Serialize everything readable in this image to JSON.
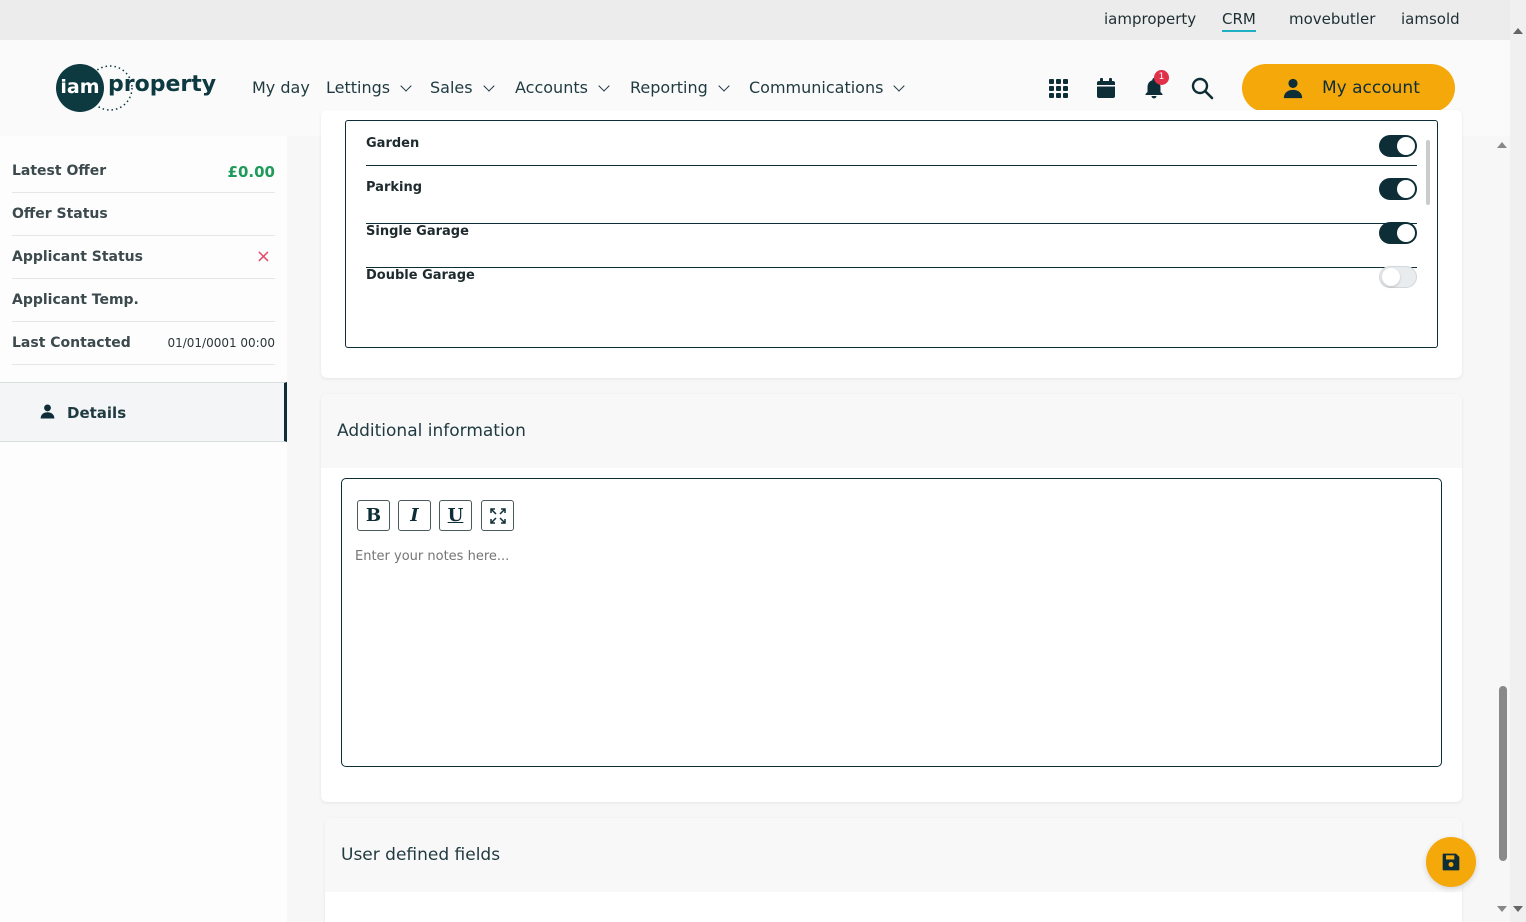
{
  "topbar": {
    "links": [
      "iamproperty",
      "CRM",
      "movebutler",
      "iamsold"
    ],
    "active": "CRM"
  },
  "header": {
    "logo_left": "iam",
    "logo_right": "property",
    "nav": [
      "My day",
      "Lettings",
      "Sales",
      "Accounts",
      "Reporting",
      "Communications"
    ],
    "notification_count": "1",
    "account_label": "My account"
  },
  "sidebar": {
    "rows": [
      {
        "label": "Latest Offer",
        "value": "£0.00"
      },
      {
        "label": "Offer Status",
        "value": ""
      },
      {
        "label": "Applicant Status",
        "value": "×"
      },
      {
        "label": "Applicant Temp.",
        "value": ""
      },
      {
        "label": "Last Contacted",
        "value": "01/01/0001 00:00"
      }
    ],
    "details_label": "Details"
  },
  "amenities": [
    {
      "label": "Garden",
      "on": true
    },
    {
      "label": "Parking",
      "on": true
    },
    {
      "label": "Single Garage",
      "on": true
    },
    {
      "label": "Double Garage",
      "on": false
    }
  ],
  "additional": {
    "title": "Additional information",
    "toolbar": [
      "B",
      "I",
      "U"
    ],
    "placeholder": "Enter your notes here..."
  },
  "user_defined": {
    "title": "User defined fields"
  },
  "colors": {
    "primary": "#0d2e36",
    "accent": "#f5a80a",
    "positive": "#1e9a5a",
    "negative": "#e34a6a"
  }
}
